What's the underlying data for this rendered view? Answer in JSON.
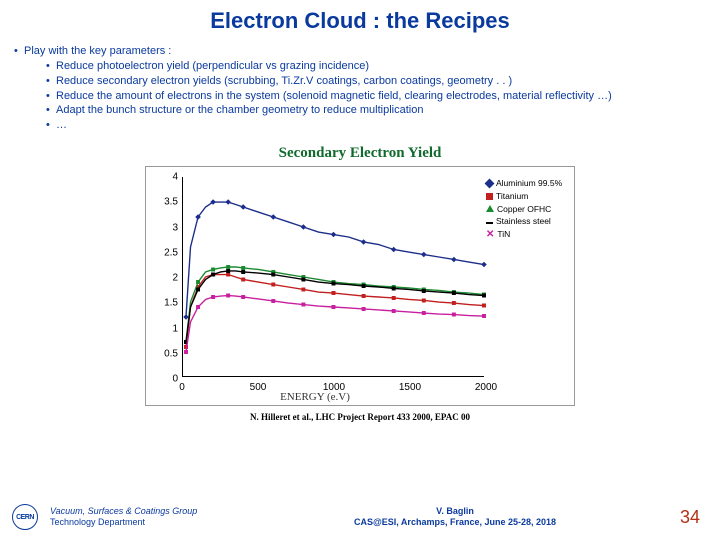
{
  "title": "Electron Cloud : the Recipes",
  "bullets": {
    "lv1": "Play with the key parameters :",
    "lv2": [
      "Reduce photoelectron yield (perpendicular vs grazing incidence)",
      "Reduce secondary electron yields (scrubbing, Ti.Zr.V coatings, carbon coatings, geometry . . )",
      "Reduce the amount of electrons in the system (solenoid magnetic field, clearing electrodes, material reflectivity …)",
      "Adapt the bunch structure or the chamber geometry to reduce multiplication",
      "…"
    ]
  },
  "chart_data": {
    "type": "line",
    "title": "Secondary Electron Yield",
    "xlabel": "ENERGY (e.V)",
    "ylabel": "",
    "xlim": [
      0,
      2000
    ],
    "ylim": [
      0,
      4
    ],
    "xticks": [
      "0",
      "500",
      "1000",
      "1500",
      "2000"
    ],
    "yticks": [
      "0",
      "0.5",
      "1",
      "1.5",
      "2",
      "2.5",
      "3",
      "3.5",
      "4"
    ],
    "x": [
      20,
      50,
      100,
      150,
      200,
      250,
      300,
      350,
      400,
      500,
      600,
      700,
      800,
      900,
      1000,
      1100,
      1200,
      1300,
      1400,
      1500,
      1600,
      1700,
      1800,
      1900,
      2000
    ],
    "series": [
      {
        "name": "Aluminium 99.5%",
        "color": "#1b2e8a",
        "marker": "diamond",
        "values": [
          1.2,
          2.6,
          3.2,
          3.4,
          3.5,
          3.5,
          3.5,
          3.45,
          3.4,
          3.3,
          3.2,
          3.1,
          3.0,
          2.9,
          2.85,
          2.8,
          2.7,
          2.65,
          2.55,
          2.5,
          2.45,
          2.4,
          2.35,
          2.3,
          2.25
        ]
      },
      {
        "name": "Titanium",
        "color": "#c21f1f",
        "marker": "square",
        "values": [
          0.6,
          1.4,
          1.8,
          2.0,
          2.05,
          2.05,
          2.05,
          2.0,
          1.95,
          1.9,
          1.85,
          1.8,
          1.75,
          1.7,
          1.68,
          1.65,
          1.62,
          1.6,
          1.58,
          1.55,
          1.53,
          1.5,
          1.48,
          1.45,
          1.43
        ]
      },
      {
        "name": "Copper OFHC",
        "color": "#1a8a2e",
        "marker": "triangle",
        "values": [
          0.7,
          1.5,
          1.9,
          2.1,
          2.15,
          2.18,
          2.2,
          2.2,
          2.18,
          2.15,
          2.1,
          2.05,
          2.0,
          1.95,
          1.9,
          1.87,
          1.85,
          1.82,
          1.8,
          1.78,
          1.75,
          1.73,
          1.7,
          1.68,
          1.65
        ]
      },
      {
        "name": "Stainless steel",
        "color": "#000000",
        "marker": "dash",
        "values": [
          0.7,
          1.4,
          1.75,
          1.95,
          2.05,
          2.1,
          2.12,
          2.12,
          2.1,
          2.08,
          2.05,
          2.0,
          1.95,
          1.9,
          1.87,
          1.85,
          1.82,
          1.8,
          1.77,
          1.75,
          1.72,
          1.7,
          1.68,
          1.65,
          1.63
        ]
      },
      {
        "name": "TiN",
        "color": "#c81fa0",
        "marker": "x",
        "values": [
          0.5,
          1.1,
          1.4,
          1.55,
          1.6,
          1.62,
          1.63,
          1.62,
          1.6,
          1.56,
          1.52,
          1.48,
          1.45,
          1.42,
          1.4,
          1.38,
          1.36,
          1.34,
          1.32,
          1.3,
          1.28,
          1.26,
          1.25,
          1.23,
          1.22
        ]
      }
    ]
  },
  "chart_credit": "N. Hilleret et al., LHC Project Report 433 2000, EPAC 00",
  "footer": {
    "logo_text": "CERN",
    "group_l1": "Vacuum, Surfaces & Coatings Group",
    "group_l2": "Technology Department",
    "center_l1": "V. Baglin",
    "center_l2": "CAS@ESI, Archamps, France, June 25-28, 2018",
    "page": "34"
  }
}
